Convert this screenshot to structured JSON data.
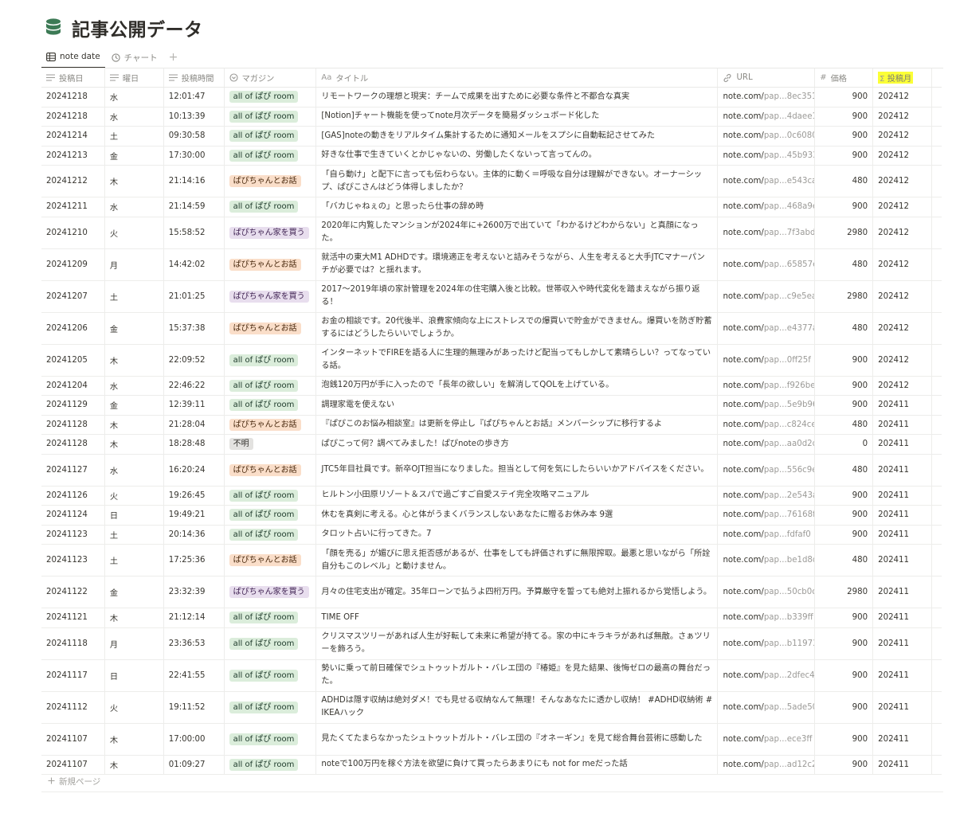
{
  "page": {
    "title": "記事公開データ",
    "icon": "database-icon"
  },
  "tabs": [
    {
      "label": "note date",
      "icon": "table-icon",
      "active": true
    },
    {
      "label": "チャート",
      "icon": "chart-clock-icon",
      "active": false
    }
  ],
  "tab_add_label": "+",
  "columns": [
    {
      "key": "date",
      "label": "投稿日",
      "icon": "text-icon"
    },
    {
      "key": "day",
      "label": "曜日",
      "icon": "text-icon"
    },
    {
      "key": "time",
      "label": "投稿時間",
      "icon": "text-icon"
    },
    {
      "key": "magazine",
      "label": "マガジン",
      "icon": "select-icon"
    },
    {
      "key": "title",
      "label": "タイトル",
      "icon": "title-icon",
      "glyph": "Aa"
    },
    {
      "key": "url",
      "label": "URL",
      "icon": "link-icon"
    },
    {
      "key": "price",
      "label": "価格",
      "icon": "number-icon",
      "glyph": "#"
    },
    {
      "key": "month",
      "label": "投稿月",
      "icon": "formula-icon",
      "glyph": "Σ",
      "highlight": "#fbff36"
    }
  ],
  "tag_colors": {
    "all of ぱぴ room": "green",
    "ぱぴちゃんとお話": "orange",
    "ぱぴちゃん家を買う": "purple",
    "不明": "gray"
  },
  "rows": [
    {
      "date": "20241218",
      "day": "水",
      "time": "12:01:47",
      "magazine": "all of ぱぴ room",
      "title": "リモートワークの理想と現実：チームで成果を出すために必要な条件と不都合な真実",
      "url_domain": "note.com/",
      "url_rest": "pap...8ec351",
      "price": "900",
      "month": "202412"
    },
    {
      "date": "20241218",
      "day": "水",
      "time": "10:13:39",
      "magazine": "all of ぱぴ room",
      "title": "[Notion]チャート機能を使ってnote月次データを簡易ダッシュボード化した",
      "url_domain": "note.com/",
      "url_rest": "pap...4daee1",
      "price": "900",
      "month": "202412"
    },
    {
      "date": "20241214",
      "day": "土",
      "time": "09:30:58",
      "magazine": "all of ぱぴ room",
      "title": "[GAS]noteの動きをリアルタイム集計するために通知メールをスプシに自動転記させてみた",
      "url_domain": "note.com/",
      "url_rest": "pap...0c6080",
      "price": "900",
      "month": "202412"
    },
    {
      "date": "20241213",
      "day": "金",
      "time": "17:30:00",
      "magazine": "all of ぱぴ room",
      "title": "好きな仕事で生きていくとかじゃないの、労働したくないって言ってんの。",
      "url_domain": "note.com/",
      "url_rest": "pap...45b933",
      "price": "900",
      "month": "202412"
    },
    {
      "date": "20241212",
      "day": "木",
      "time": "21:14:16",
      "magazine": "ぱぴちゃんとお話",
      "title": "「自ら動け」と配下に言っても伝わらない。主体的に動く＝呼吸な自分は理解ができない。オーナーシップ、ぱぴこさんはどう体得しましたか？",
      "url_domain": "note.com/",
      "url_rest": "pap...e543ca",
      "price": "480",
      "month": "202412"
    },
    {
      "date": "20241211",
      "day": "水",
      "time": "21:14:59",
      "magazine": "all of ぱぴ room",
      "title": "「バカじゃねぇの」と思ったら仕事の辞め時",
      "url_domain": "note.com/",
      "url_rest": "pap...468a9e",
      "price": "900",
      "month": "202412"
    },
    {
      "date": "20241210",
      "day": "火",
      "time": "15:58:52",
      "magazine": "ぱぴちゃん家を買う",
      "title": "2020年に内覧したマンションが2024年に+2600万で出ていて「わかるけどわからない」と真顔になった。",
      "url_domain": "note.com/",
      "url_rest": "pap...7f3abd",
      "price": "2980",
      "month": "202412"
    },
    {
      "date": "20241209",
      "day": "月",
      "time": "14:42:02",
      "magazine": "ぱぴちゃんとお話",
      "title": "就活中の東大M1 ADHDです。環境適正を考えないと詰みそうながら、人生を考えると大手JTCマナーパンチが必要では？と揺れます。",
      "url_domain": "note.com/",
      "url_rest": "pap...65857e",
      "price": "480",
      "month": "202412"
    },
    {
      "date": "20241207",
      "day": "土",
      "time": "21:01:25",
      "magazine": "ぱぴちゃん家を買う",
      "title": "2017〜2019年頃の家計管理を2024年の住宅購入後と比較。世帯収入や時代変化を踏まえながら振り返る！",
      "url_domain": "note.com/",
      "url_rest": "pap...c9e5ea",
      "price": "2980",
      "month": "202412"
    },
    {
      "date": "20241206",
      "day": "金",
      "time": "15:37:38",
      "magazine": "ぱぴちゃんとお話",
      "title": "お金の相談です。20代後半、浪費家傾向な上にストレスでの爆買いで貯金ができません。爆買いを防ぎ貯蓄するにはどうしたらいいでしょうか。",
      "url_domain": "note.com/",
      "url_rest": "pap...e4377a",
      "price": "480",
      "month": "202412"
    },
    {
      "date": "20241205",
      "day": "木",
      "time": "22:09:52",
      "magazine": "all of ぱぴ room",
      "title": "インターネットでFIREを語る人に生理的無理みがあったけど配当ってもしかして素晴らしい？ってなっている話。",
      "url_domain": "note.com/",
      "url_rest": "pap...0ff25f",
      "price": "900",
      "month": "202412"
    },
    {
      "date": "20241204",
      "day": "水",
      "time": "22:46:22",
      "magazine": "all of ぱぴ room",
      "title": "泡銭120万円が手に入ったので「長年の欲しい」を解消してQOLを上げている。",
      "url_domain": "note.com/",
      "url_rest": "pap...f926be",
      "price": "900",
      "month": "202412"
    },
    {
      "date": "20241129",
      "day": "金",
      "time": "12:39:11",
      "magazine": "all of ぱぴ room",
      "title": "調理家電を使えない",
      "url_domain": "note.com/",
      "url_rest": "pap...5e9b96",
      "price": "900",
      "month": "202411"
    },
    {
      "date": "20241128",
      "day": "木",
      "time": "21:28:04",
      "magazine": "ぱぴちゃんとお話",
      "title": "『ぱぴこのお悩み相談室』は更新を停止し『ぱぴちゃんとお話』メンバーシップに移行するよ",
      "url_domain": "note.com/",
      "url_rest": "pap...c824ce",
      "price": "480",
      "month": "202411"
    },
    {
      "date": "20241128",
      "day": "木",
      "time": "18:28:48",
      "magazine": "不明",
      "title": "ぱぴこって何？調べてみました！ぱぴnoteの歩き方",
      "url_domain": "note.com/",
      "url_rest": "pap...aa0d2d",
      "price": "0",
      "month": "202411"
    },
    {
      "date": "20241127",
      "day": "水",
      "time": "16:20:24",
      "magazine": "ぱぴちゃんとお話",
      "title": "JTC5年目社員です。新卒OJT担当になりました。担当として何を気にしたらいいかアドバイスをください。",
      "url_domain": "note.com/",
      "url_rest": "pap...556c9e",
      "price": "480",
      "month": "202411"
    },
    {
      "date": "20241126",
      "day": "火",
      "time": "19:26:45",
      "magazine": "all of ぱぴ room",
      "title": "ヒルトン小田原リゾート＆スパで過ごすご自愛ステイ完全攻略マニュアル",
      "url_domain": "note.com/",
      "url_rest": "pap...2e543a",
      "price": "900",
      "month": "202411"
    },
    {
      "date": "20241124",
      "day": "日",
      "time": "19:49:21",
      "magazine": "all of ぱぴ room",
      "title": "休むを真剣に考える。心と体がうまくバランスしないあなたに贈るお休み本 9選",
      "url_domain": "note.com/",
      "url_rest": "pap...76168f",
      "price": "900",
      "month": "202411"
    },
    {
      "date": "20241123",
      "day": "土",
      "time": "20:14:36",
      "magazine": "all of ぱぴ room",
      "title": "タロット占いに行ってきた。7",
      "url_domain": "note.com/",
      "url_rest": "pap...fdfaf0",
      "price": "900",
      "month": "202411"
    },
    {
      "date": "20241123",
      "day": "土",
      "time": "17:25:36",
      "magazine": "ぱぴちゃんとお話",
      "title": "「顔を売る」が媚びに思え拒否感があるが、仕事をしても評価されずに無限搾取。最悪と思いながら「所詮自分もこのレベル」と動けません。",
      "url_domain": "note.com/",
      "url_rest": "pap...be1d8d",
      "price": "480",
      "month": "202411"
    },
    {
      "date": "20241122",
      "day": "金",
      "time": "23:32:39",
      "magazine": "ぱぴちゃん家を買う",
      "title": "月々の住宅支出が確定。35年ローンで払うよ四桁万円。予算厳守を誓っても絶対上振れるから覚悟しよう。",
      "url_domain": "note.com/",
      "url_rest": "pap...50cb0c",
      "price": "2980",
      "month": "202411"
    },
    {
      "date": "20241121",
      "day": "木",
      "time": "21:12:14",
      "magazine": "all of ぱぴ room",
      "title": "TIME OFF",
      "url_domain": "note.com/",
      "url_rest": "pap...b339ff",
      "price": "900",
      "month": "202411"
    },
    {
      "date": "20241118",
      "day": "月",
      "time": "23:36:53",
      "magazine": "all of ぱぴ room",
      "title": "クリスマスツリーがあれば人生が好転して未来に希望が持てる。家の中にキラキラがあれば無敵。さぁツリーを飾ろう。",
      "url_domain": "note.com/",
      "url_rest": "pap...b11973",
      "price": "900",
      "month": "202411"
    },
    {
      "date": "20241117",
      "day": "日",
      "time": "22:41:55",
      "magazine": "all of ぱぴ room",
      "title": "勢いに乗って前日確保でシュトゥットガルト・バレエ団の『椿姫』を見た結果、後悔ゼロの最高の舞台だった。",
      "url_domain": "note.com/",
      "url_rest": "pap...2dfec4",
      "price": "900",
      "month": "202411"
    },
    {
      "date": "20241112",
      "day": "火",
      "time": "19:11:52",
      "magazine": "all of ぱぴ room",
      "title": "ADHDは隠す収納は絶対ダメ！でも見せる収納なんて無理！そんなあなたに透かし収納！ #ADHD収納術 #IKEAハック",
      "url_domain": "note.com/",
      "url_rest": "pap...5ade50",
      "price": "900",
      "month": "202411"
    },
    {
      "date": "20241107",
      "day": "木",
      "time": "17:00:00",
      "magazine": "all of ぱぴ room",
      "title": "見たくてたまらなかったシュトゥットガルト・バレエ団の『オネーギン』を見て総合舞台芸術に感動した",
      "url_domain": "note.com/",
      "url_rest": "pap...ece3ff",
      "price": "900",
      "month": "202411"
    },
    {
      "date": "20241107",
      "day": "木",
      "time": "01:09:27",
      "magazine": "all of ぱぴ room",
      "title": "noteで100万円を稼ぐ方法を欲望に負けて買ったらあまりにも not for meだった話",
      "url_domain": "note.com/",
      "url_rest": "pap...ad12c2",
      "price": "900",
      "month": "202411"
    }
  ],
  "new_page_label": "新規ページ",
  "accent_colors": {
    "formula_highlight": "#fbff36",
    "db_icon": "#3c7a55"
  }
}
